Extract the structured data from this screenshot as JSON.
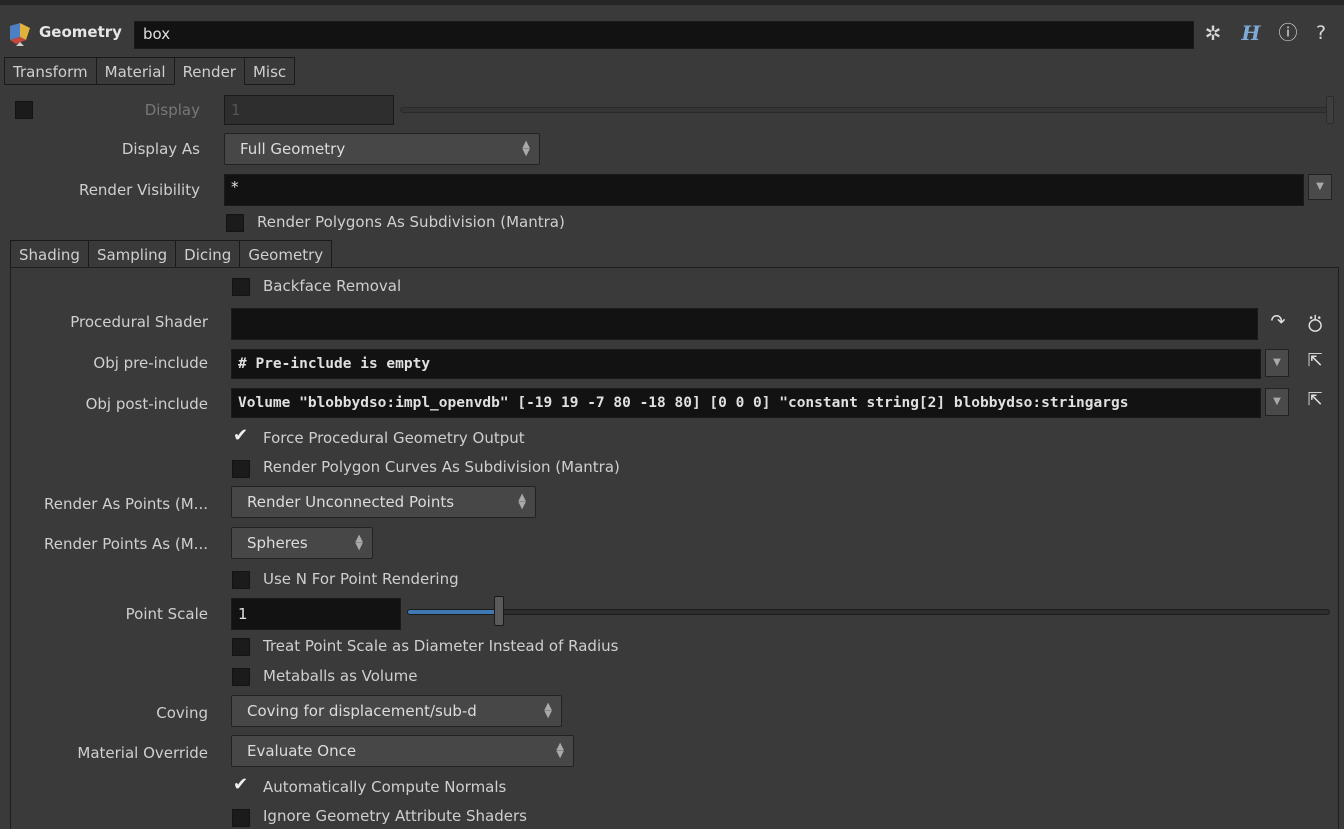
{
  "header": {
    "node_type": "Geometry",
    "node_name": "box",
    "icons": [
      "geometry-node-icon",
      "gear-icon",
      "houdini-help-icon",
      "info-icon",
      "help-icon"
    ]
  },
  "main_tabs": [
    "Transform",
    "Material",
    "Render",
    "Misc"
  ],
  "main_active_tab": "Render",
  "render": {
    "display_label": "Display",
    "display_value": "1",
    "display_as_label": "Display As",
    "display_as_value": "Full Geometry",
    "render_visibility_label": "Render Visibility",
    "render_visibility_value": "*",
    "render_polygons_subdivision": "Render Polygons As Subdivision (Mantra)"
  },
  "sub_tabs": [
    "Shading",
    "Sampling",
    "Dicing",
    "Geometry"
  ],
  "sub_active_tab": "Geometry",
  "geometry": {
    "backface_removal": "Backface Removal",
    "procedural_shader_label": "Procedural Shader",
    "procedural_shader_value": "",
    "obj_pre_include_label": "Obj pre-include",
    "obj_pre_include_value": "# Pre-include is empty",
    "obj_post_include_label": "Obj post-include",
    "obj_post_include_value": "Volume \"blobbydso:impl_openvdb\" [-19 19 -7 80 -18 80] [0 0 0] \"constant string[2] blobbydso:stringargs",
    "force_procedural_output": "Force Procedural Geometry Output",
    "render_polygon_curves_subdivision": "Render Polygon Curves As Subdivision (Mantra)",
    "render_as_points_label": "Render As Points (M...",
    "render_as_points_value": "Render Unconnected Points",
    "render_points_as_label": "Render Points As (M...",
    "render_points_as_value": "Spheres",
    "use_n_point_rendering": "Use N For Point Rendering",
    "point_scale_label": "Point Scale",
    "point_scale_value": "1",
    "point_scale_slider_fraction": 0.1,
    "treat_point_scale_diameter": "Treat Point Scale as Diameter Instead of Radius",
    "metaballs_as_volume": "Metaballs as Volume",
    "coving_label": "Coving",
    "coving_value": "Coving for displacement/sub-d",
    "material_override_label": "Material Override",
    "material_override_value": "Evaluate Once",
    "auto_compute_normals": "Automatically Compute Normals",
    "ignore_geometry_attribute_shaders": "Ignore Geometry Attribute Shaders"
  },
  "colors": {
    "background": "#3a3a3a",
    "field": "#121212",
    "slider_fill": "#3e79b3"
  }
}
